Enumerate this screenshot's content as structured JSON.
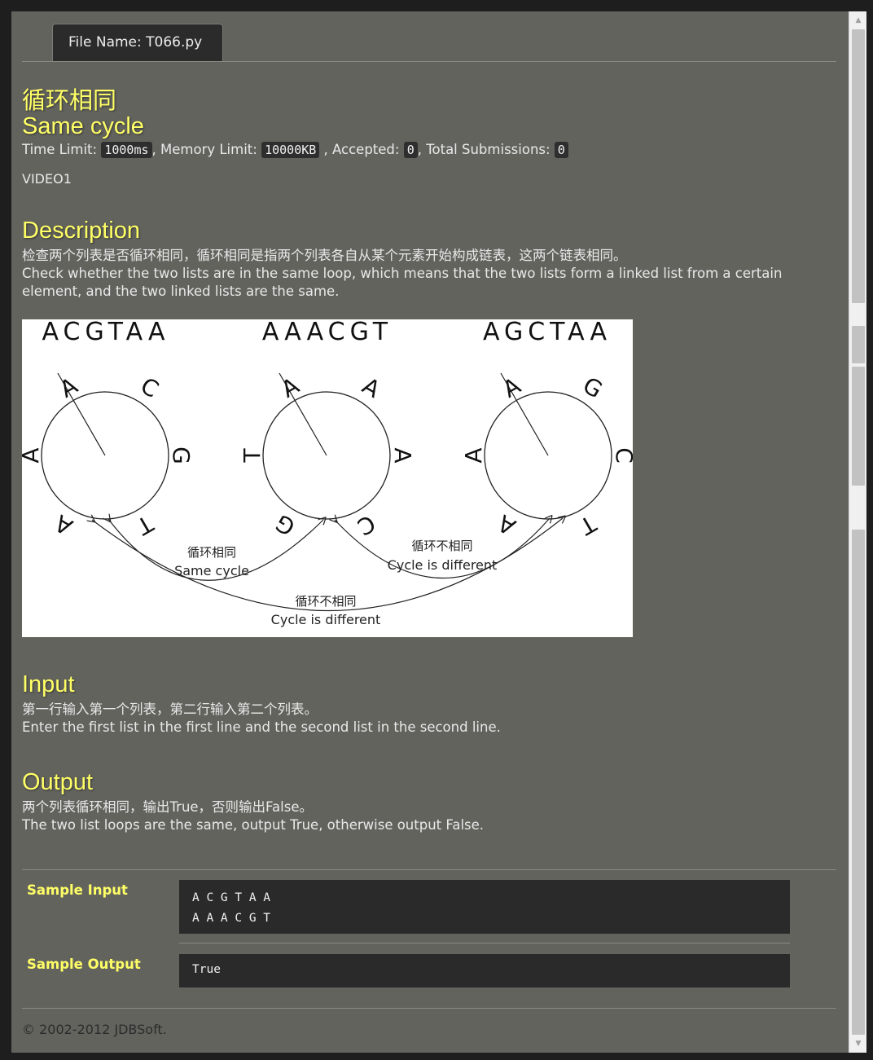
{
  "tab": {
    "label": "File Name:  T066.py"
  },
  "problem": {
    "title_zh": "循环相同",
    "title_en": "Same cycle",
    "limits": {
      "time_label": "Time Limit: ",
      "time_value": "1000ms",
      "memory_label": ", Memory Limit: ",
      "memory_value": "10000KB",
      "accepted_label": " , Accepted: ",
      "accepted_value": "0",
      "submissions_label": ", Total Submissions: ",
      "submissions_value": "0"
    },
    "video": "VIDEO1"
  },
  "description": {
    "heading": "Description",
    "zh": "检查两个列表是否循环相同，循环相同是指两个列表各自从某个元素开始构成链表，这两个链表相同。",
    "en": "Check whether the two lists are in the same loop, which means that the two lists form a linked list from a certain element, and the two linked lists are the same."
  },
  "figure": {
    "sequences": [
      "ACGTAA",
      "AAACGT",
      "AGCTAA"
    ],
    "circle1_letters": {
      "top_left": "A",
      "top_right": "C",
      "right": "G",
      "bottom_right": "T",
      "bottom_left": "A",
      "left": "A"
    },
    "circle2_letters": {
      "top_left": "A",
      "top_right": "A",
      "right": "A",
      "bottom_right": "C",
      "bottom_left": "G",
      "left": "T"
    },
    "circle3_letters": {
      "top_left": "A",
      "top_right": "G",
      "right": "C",
      "bottom_right": "T",
      "bottom_left": "A",
      "left": "A"
    },
    "arc1_zh": "循环相同",
    "arc1_en": "Same cycle",
    "arc2_zh": "循环不相同",
    "arc2_en": "Cycle is different",
    "arc3_zh": "循环不相同",
    "arc3_en": "Cycle is different"
  },
  "input": {
    "heading": "Input",
    "zh": "第一行输入第一个列表，第二行输入第二个列表。",
    "en": "Enter the first list in the first line and the second list in the second line."
  },
  "output": {
    "heading": "Output",
    "zh": "两个列表循环相同，输出True，否则输出False。",
    "en": "The two list loops are the same, output True, otherwise output False."
  },
  "samples": {
    "input_label": "Sample Input",
    "input_value": "A C G T A A\nA A A C G T",
    "output_label": "Sample Output",
    "output_value": "True"
  },
  "footer": "© 2002-2012  JDBSoft.",
  "colors": {
    "background": "#63635e",
    "heading": "#ffff66",
    "code_bg": "#2a2a2a"
  }
}
